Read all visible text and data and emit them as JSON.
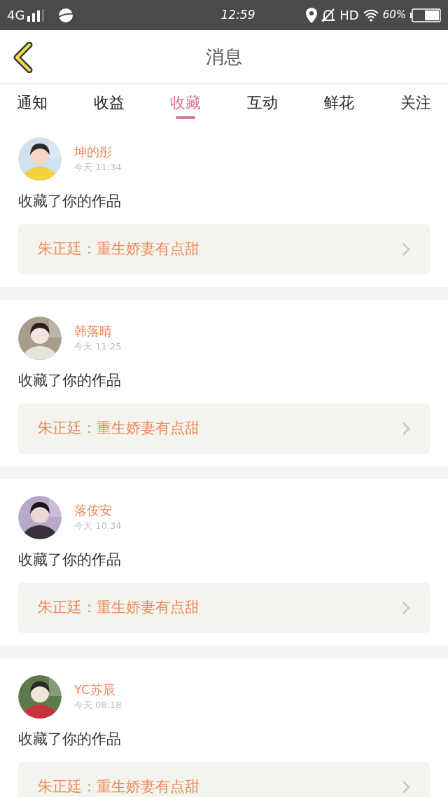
{
  "status_bar": {
    "network": "4G",
    "time": "12:59",
    "hd": "HD",
    "battery": "60%"
  },
  "header": {
    "title": "消息"
  },
  "tabs": [
    {
      "label": "通知",
      "selected": false
    },
    {
      "label": "收益",
      "selected": false
    },
    {
      "label": "收藏",
      "selected": true
    },
    {
      "label": "互动",
      "selected": false
    },
    {
      "label": "鲜花",
      "selected": false
    },
    {
      "label": "关注",
      "selected": false
    }
  ],
  "messages": [
    {
      "name": "坤的彤",
      "time": "今天 11:34",
      "text": "收藏了你的作品",
      "work": "朱正廷：重生娇妻有点甜"
    },
    {
      "name": "韩落晴",
      "time": "今天 11:25",
      "text": "收藏了你的作品",
      "work": "朱正廷：重生娇妻有点甜"
    },
    {
      "name": "落侒安",
      "time": "今天 10:34",
      "text": "收藏了你的作品",
      "work": "朱正廷：重生娇妻有点甜"
    },
    {
      "name": "YC苏辰",
      "time": "今天 08:18",
      "text": "收藏了你的作品",
      "work": "朱正廷：重生娇妻有点甜"
    }
  ]
}
